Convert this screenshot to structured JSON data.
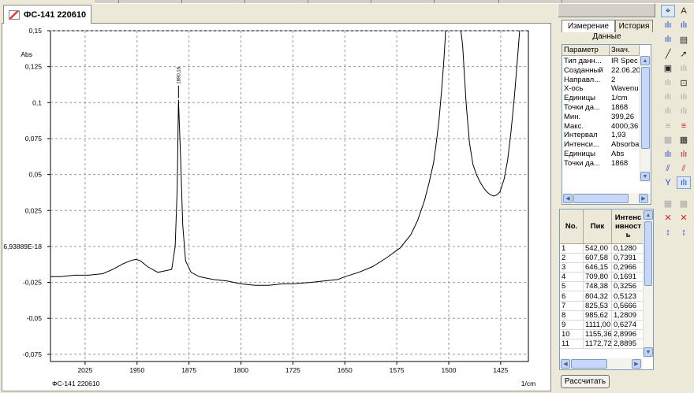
{
  "document_tab": {
    "title": "ФС-141  220610"
  },
  "side_tabs": {
    "measure": "Измерение",
    "history": "История"
  },
  "data_title": "Данные",
  "props": {
    "header": {
      "param": "Параметр",
      "value": "Знач."
    },
    "rows": [
      {
        "name": "Тип данн...",
        "value": "IR Spec"
      },
      {
        "name": "Созданный",
        "value": "22.06.20"
      },
      {
        "name": "Направл...",
        "value": "2"
      },
      {
        "name": "X-ось",
        "value": "Wavenu"
      },
      {
        "name": "Единицы",
        "value": "1/cm"
      },
      {
        "name": "Точки да...",
        "value": "1868"
      },
      {
        "name": "Мин.",
        "value": "399,26"
      },
      {
        "name": "Макс.",
        "value": "4000,36"
      },
      {
        "name": "Интервал",
        "value": "1,93"
      },
      {
        "name": "Интенси...",
        "value": "Absorba"
      },
      {
        "name": "Единицы",
        "value": "Abs"
      },
      {
        "name": "Точки да...",
        "value": "1868"
      }
    ]
  },
  "peaks_table": {
    "headers": {
      "no": "No.",
      "peak": "Пик",
      "intensity": "Интенсивность"
    },
    "rows": [
      {
        "no": "1",
        "peak": "542,00",
        "intensity": "0,1280"
      },
      {
        "no": "2",
        "peak": "607,58",
        "intensity": "0,7391"
      },
      {
        "no": "3",
        "peak": "646,15",
        "intensity": "0,2966"
      },
      {
        "no": "4",
        "peak": "709,80",
        "intensity": "0,1691"
      },
      {
        "no": "5",
        "peak": "748,38",
        "intensity": "0,3256"
      },
      {
        "no": "6",
        "peak": "804,32",
        "intensity": "0,5123"
      },
      {
        "no": "7",
        "peak": "825,53",
        "intensity": "0,5666"
      },
      {
        "no": "8",
        "peak": "985,62",
        "intensity": "1,2809"
      },
      {
        "no": "9",
        "peak": "1111,00",
        "intensity": "0,6274"
      },
      {
        "no": "10",
        "peak": "1155,36",
        "intensity": "2,8996"
      },
      {
        "no": "11",
        "peak": "1172,72",
        "intensity": "2,8895"
      }
    ]
  },
  "calc_button": "Рассчитать",
  "toolbar_icons": [
    "cursor-icon",
    "font-icon",
    "peak-pick-icon",
    "peak-pick-auto-icon",
    "peak-area-icon",
    "report-icon",
    "line-icon",
    "arrow-icon",
    "image-icon",
    "spectrum-gray-icon",
    "baseline-gray-icon",
    "zoom-box-icon",
    "peaks-gray-icon",
    "peaks-gray2-icon",
    "normalize-gray-icon",
    "scale-gray-icon",
    "list-gray-icon",
    "list-red-icon",
    "table-gray-icon",
    "table-color-icon",
    "blue-peaks-icon",
    "red-peaks-icon",
    "peak-label-icon",
    "peak-label-red-icon",
    "valley-icon",
    "peak-mark-icon",
    "grid-gray-icon",
    "grid-gray2-icon",
    "x-cross-red-icon",
    "x-cross-red2-icon",
    "y-adjust-icon",
    "y-adjust2-icon"
  ],
  "chart_data": {
    "type": "line",
    "ylabel": "Abs",
    "xlabel": "1/cm",
    "x_reversed": true,
    "xlim": [
      2075,
      1385
    ],
    "ylim": [
      -0.08,
      0.15
    ],
    "y_ticks": [
      "0,15",
      "0,125",
      "0,1",
      "0,075",
      "0,05",
      "0,025",
      "6,93889E-18",
      "-0,025",
      "-0,05",
      "-0,075"
    ],
    "y_tick_values": [
      0.15,
      0.125,
      0.1,
      0.075,
      0.05,
      0.025,
      0,
      -0.025,
      -0.05,
      -0.075
    ],
    "x_ticks": [
      "2025",
      "1950",
      "1875",
      "1800",
      "1725",
      "1650",
      "1575",
      "1500",
      "1425"
    ],
    "x_tick_values": [
      2025,
      1950,
      1875,
      1800,
      1725,
      1650,
      1575,
      1500,
      1425
    ],
    "legend_label": "ФС-141  220610",
    "peak_annotation": {
      "x": 1890.16,
      "label": "1890,16"
    },
    "series": [
      {
        "color": "#000000",
        "x": [
          2075,
          2060,
          2040,
          2020,
          2000,
          1985,
          1970,
          1960,
          1952,
          1945,
          1935,
          1920,
          1900,
          1895,
          1892,
          1890.16,
          1887,
          1884,
          1880,
          1872,
          1860,
          1840,
          1820,
          1800,
          1780,
          1760,
          1740,
          1725,
          1700,
          1680,
          1660,
          1650,
          1630,
          1610,
          1590,
          1570,
          1555,
          1545,
          1535,
          1528,
          1522,
          1518,
          1514,
          1510,
          1507,
          1505,
          1504
        ],
        "y": [
          -0.021,
          -0.021,
          -0.02,
          -0.02,
          -0.019,
          -0.016,
          -0.012,
          -0.01,
          -0.009,
          -0.01,
          -0.014,
          -0.018,
          -0.016,
          0.0,
          0.04,
          0.102,
          0.06,
          0.015,
          -0.01,
          -0.018,
          -0.021,
          -0.023,
          -0.024,
          -0.026,
          -0.027,
          -0.027,
          -0.026,
          -0.026,
          -0.025,
          -0.024,
          -0.023,
          -0.021,
          -0.018,
          -0.014,
          -0.008,
          -0.001,
          0.008,
          0.018,
          0.032,
          0.045,
          0.058,
          0.072,
          0.088,
          0.11,
          0.13,
          0.145,
          0.16
        ]
      },
      {
        "color": "#000000",
        "x": [
          1485,
          1480,
          1475,
          1470,
          1465,
          1460,
          1455,
          1450,
          1445,
          1440,
          1435,
          1430,
          1426,
          1420,
          1415,
          1410,
          1405,
          1400,
          1396
        ],
        "y": [
          0.16,
          0.14,
          0.1,
          0.072,
          0.057,
          0.05,
          0.045,
          0.041,
          0.038,
          0.036,
          0.035,
          0.036,
          0.038,
          0.047,
          0.06,
          0.08,
          0.105,
          0.135,
          0.16
        ]
      }
    ]
  }
}
